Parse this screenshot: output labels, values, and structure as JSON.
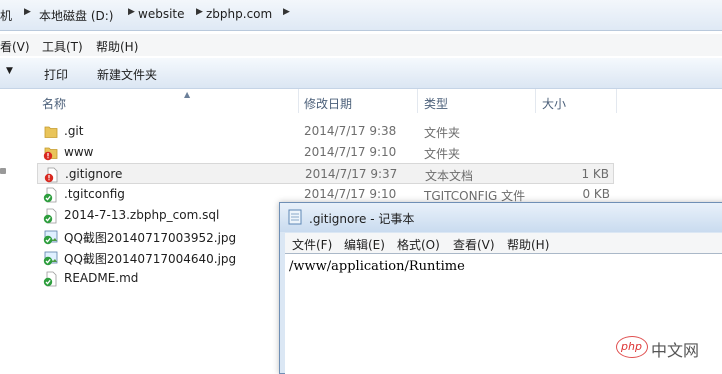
{
  "breadcrumb": {
    "items": [
      "机",
      "本地磁盘 (D:)",
      "website",
      "zbphp.com"
    ]
  },
  "menubar": {
    "items": [
      "看(V)",
      "工具(T)",
      "帮助(H)"
    ]
  },
  "commandbar": {
    "print_label": "打印",
    "new_folder_label": "新建文件夹"
  },
  "columns": {
    "name": "名称",
    "date": "修改日期",
    "type": "类型",
    "size": "大小"
  },
  "files": [
    {
      "name": ".git",
      "date": "2014/7/17 9:38",
      "type": "文件夹",
      "size": "",
      "icon": "folder-icon"
    },
    {
      "name": "www",
      "date": "2014/7/17 9:10",
      "type": "文件夹",
      "size": "",
      "icon": "folder-modified-icon"
    },
    {
      "name": ".gitignore",
      "date": "2014/7/17 9:37",
      "type": "文本文档",
      "size": "1 KB",
      "icon": "file-modified-icon"
    },
    {
      "name": ".tgitconfig",
      "date": "2014/7/17 9:10",
      "type": "TGITCONFIG 文件",
      "size": "0 KB",
      "icon": "file-ok-icon"
    },
    {
      "name": "2014-7-13.zbphp_com.sql",
      "date": "",
      "type": "",
      "size": "",
      "icon": "file-ok-icon"
    },
    {
      "name": "QQ截图20140717003952.jpg",
      "date": "",
      "type": "",
      "size": "",
      "icon": "image-ok-icon"
    },
    {
      "name": "QQ截图20140717004640.jpg",
      "date": "",
      "type": "",
      "size": "",
      "icon": "image-ok-icon"
    },
    {
      "name": "README.md",
      "date": "",
      "type": "",
      "size": "",
      "icon": "file-ok-icon"
    }
  ],
  "notepad": {
    "title": ".gitignore - 记事本",
    "menu": [
      "文件(F)",
      "编辑(E)",
      "格式(O)",
      "查看(V)",
      "帮助(H)"
    ],
    "content": "/www/application/Runtime"
  },
  "watermark": {
    "badge": "php",
    "site": "中文网"
  }
}
